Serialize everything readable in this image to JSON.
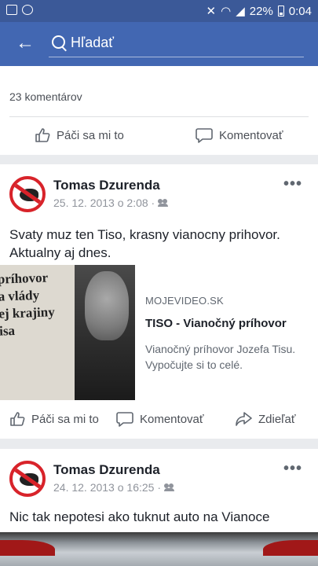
{
  "statusbar": {
    "battery": "22%",
    "time": "0:04"
  },
  "search": {
    "placeholder": "Hľadať"
  },
  "previous_post": {
    "comments_count": "23 komentárov",
    "like_label": "Páči sa mi to",
    "comment_label": "Komentovať"
  },
  "posts": [
    {
      "author": "Tomas Dzurenda",
      "date": "25. 12. 2013 o 2:08 ·",
      "text": "Svaty muz ten Tiso, krasny vianocny prihovor. Aktualny aj dnes.",
      "link": {
        "thumbnail_text": "príhovor\na vlády\nej krajiny\nisa",
        "source": "MOJEVIDEO.SK",
        "title": "TISO - Vianočný príhovor",
        "description": "Vianočný príhovor Jozefa Tisu. Vypočujte si to celé."
      },
      "actions": {
        "like": "Páči sa mi to",
        "comment": "Komentovať",
        "share": "Zdieľať"
      }
    },
    {
      "author": "Tomas Dzurenda",
      "date": "24. 12. 2013 o 16:25 ·",
      "text": "Nic tak nepotesi ako tuknut auto na Vianoce"
    }
  ],
  "colors": {
    "facebook_blue": "#4267b2",
    "statusbar_blue": "#3b5998",
    "feed_background": "#e9ebee"
  }
}
